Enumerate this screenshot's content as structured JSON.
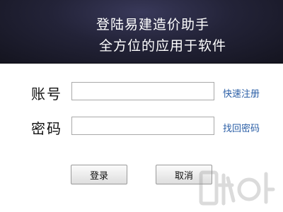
{
  "header": {
    "line1": "登陆易建造价助手",
    "line2": "全方位的应用于软件"
  },
  "form": {
    "account_label": "账号",
    "account_value": "",
    "password_label": "密码",
    "password_value": "",
    "register_link": "快速注册",
    "recover_link": "找回密码"
  },
  "buttons": {
    "login_label": "登录",
    "cancel_label": "取消"
  },
  "colors": {
    "banner": "#232338",
    "link": "#2a5ea6"
  }
}
